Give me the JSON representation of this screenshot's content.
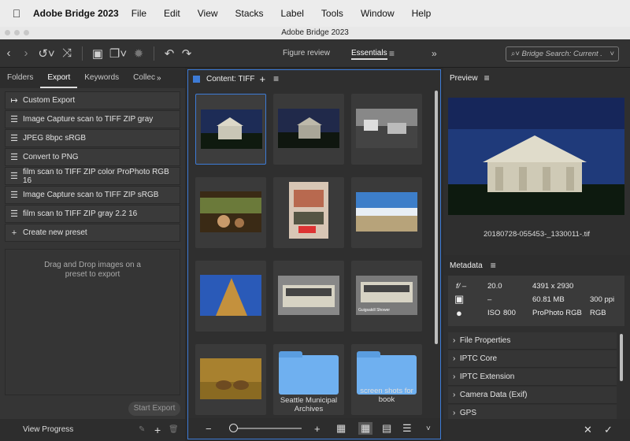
{
  "menubar": {
    "app_name": "Adobe Bridge 2023",
    "items": [
      "File",
      "Edit",
      "View",
      "Stacks",
      "Label",
      "Tools",
      "Window",
      "Help"
    ]
  },
  "window": {
    "title": "Adobe Bridge 2023"
  },
  "toolbar": {
    "workspaces": [
      "Figure review",
      "Essentials"
    ],
    "active_workspace": "Essentials",
    "search_placeholder": "Bridge Search: Current ."
  },
  "left_panel": {
    "tabs": [
      "Folders",
      "Export",
      "Keywords",
      "Collec"
    ],
    "active_tab": "Export",
    "custom_export": "Custom Export",
    "presets": [
      "Image Capture scan to TIFF ZIP gray",
      "JPEG 8bpc sRGB",
      "Convert to PNG",
      "film scan to TIFF ZIP color ProPhoto RGB 16",
      "Image Capture scan to TIFF ZIP sRGB",
      "film scan to TIFF ZIP gray 2.2 16"
    ],
    "create_preset": "Create new preset",
    "drop_hint_1": "Drag and Drop images on a",
    "drop_hint_2": "preset to export",
    "start_export": "Start Export",
    "view_progress": "View Progress"
  },
  "content": {
    "title": "Content: TIFF",
    "folders": [
      "Seattle Municipal Archives",
      "screen shots for book"
    ],
    "thumb_caption": "Guigsakill Shower"
  },
  "preview": {
    "title": "Preview",
    "filename": "20180728-055453-_1330011-.tif"
  },
  "metadata": {
    "title": "Metadata",
    "aperture": "20.0",
    "shutter": "–",
    "iso": "800",
    "iso_label": "ISO",
    "f_label": "f/ –",
    "dimensions": "4391 x 2930",
    "size": "60.81 MB",
    "ppi": "300 ppi",
    "profile": "ProPhoto RGB",
    "mode": "RGB",
    "sections": [
      "File Properties",
      "IPTC Core",
      "IPTC Extension",
      "Camera Data (Exif)",
      "GPS"
    ]
  },
  "colors": {
    "accent": "#3d7bd6",
    "folder": "#6fb0f0"
  }
}
